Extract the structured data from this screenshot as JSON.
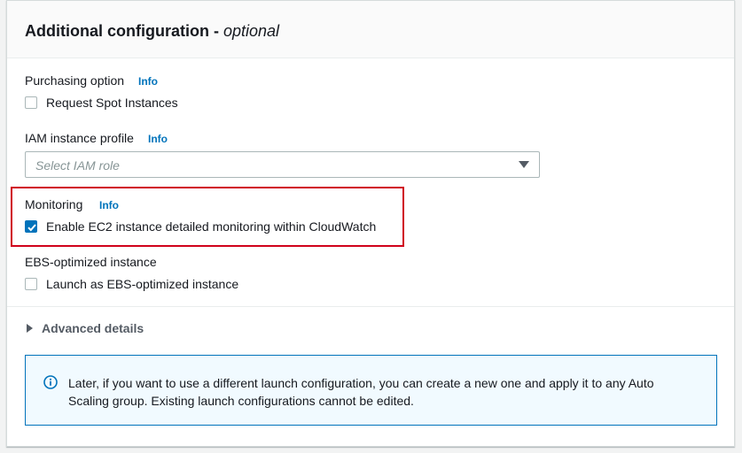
{
  "header": {
    "title": "Additional configuration - ",
    "title_emphasis": "optional"
  },
  "purchasing": {
    "label": "Purchasing option",
    "info": "Info",
    "checkbox_label": "Request Spot Instances",
    "checked": false
  },
  "iam": {
    "label": "IAM instance profile",
    "info": "Info",
    "placeholder": "Select IAM role"
  },
  "monitoring": {
    "label": "Monitoring",
    "info": "Info",
    "checkbox_label": "Enable EC2 instance detailed monitoring within CloudWatch",
    "checked": true
  },
  "ebs": {
    "label": "EBS-optimized instance",
    "checkbox_label": "Launch as EBS-optimized instance",
    "checked": false
  },
  "advanced": {
    "label": "Advanced details"
  },
  "alert": {
    "icon": "info-circle-icon",
    "text": "Later, if you want to use a different launch configuration, you can create a new one and apply it to any Auto Scaling group. Existing launch configurations cannot be edited."
  },
  "colors": {
    "accent": "#0073bb",
    "highlight": "#d0021b",
    "alert_bg": "#f1faff"
  }
}
